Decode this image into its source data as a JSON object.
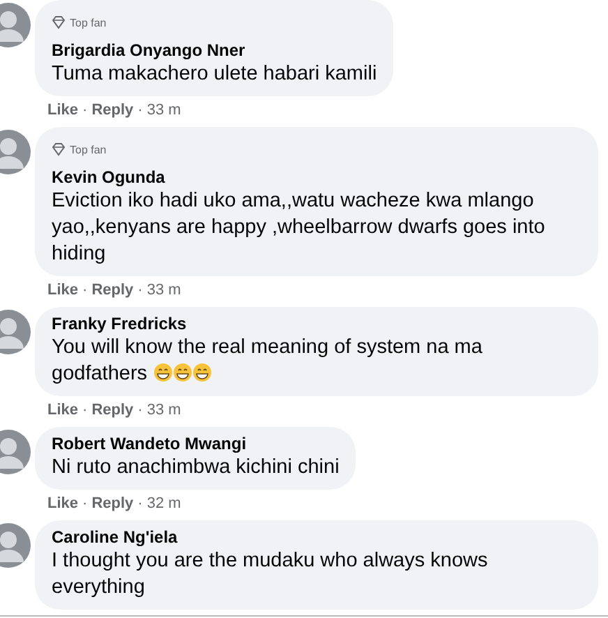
{
  "comments": [
    {
      "top_fan": true,
      "badge": "Top fan",
      "author": "Brigardia Onyango Nner",
      "text": "Tuma makachero ulete habari kamili",
      "meta": [
        {
          "kind": "link",
          "text": "Like"
        },
        {
          "kind": "sep",
          "text": "·"
        },
        {
          "kind": "link",
          "text": "Reply"
        },
        {
          "kind": "sep",
          "text": "·"
        },
        {
          "kind": "time",
          "text": "33 m"
        }
      ]
    },
    {
      "top_fan": true,
      "badge": "Top fan",
      "author": "Kevin Ogunda",
      "text": "Eviction iko hadi uko ama,,watu wacheze kwa mlango yao,,kenyans are happy ,wheelbarrow dwarfs goes into hiding",
      "meta": [
        {
          "kind": "link",
          "text": "Like"
        },
        {
          "kind": "sep",
          "text": "·"
        },
        {
          "kind": "link",
          "text": "Reply"
        },
        {
          "kind": "sep",
          "text": "·"
        },
        {
          "kind": "time",
          "text": "33 m"
        }
      ]
    },
    {
      "top_fan": false,
      "author": "Franky Fredricks",
      "text": "You will know the real meaning of system na ma godfathers",
      "emojis": [
        {
          "kind": "grin"
        },
        {
          "kind": "grin"
        },
        {
          "kind": "grin"
        }
      ],
      "meta": [
        {
          "kind": "link",
          "text": "Like"
        },
        {
          "kind": "sep",
          "text": "·"
        },
        {
          "kind": "link",
          "text": "Reply"
        },
        {
          "kind": "sep",
          "text": "·"
        },
        {
          "kind": "time",
          "text": "33 m"
        }
      ]
    },
    {
      "top_fan": false,
      "author": "Robert Wandeto Mwangi",
      "text": "Ni ruto anachimbwa kichini chini",
      "meta": [
        {
          "kind": "link",
          "text": "Like"
        },
        {
          "kind": "sep",
          "text": "·"
        },
        {
          "kind": "link",
          "text": "Reply"
        },
        {
          "kind": "sep",
          "text": "·"
        },
        {
          "kind": "time",
          "text": "32 m"
        }
      ]
    },
    {
      "top_fan": false,
      "author": "Caroline Ng'iela",
      "text": "I thought you are the mudaku who always knows everything"
    }
  ]
}
